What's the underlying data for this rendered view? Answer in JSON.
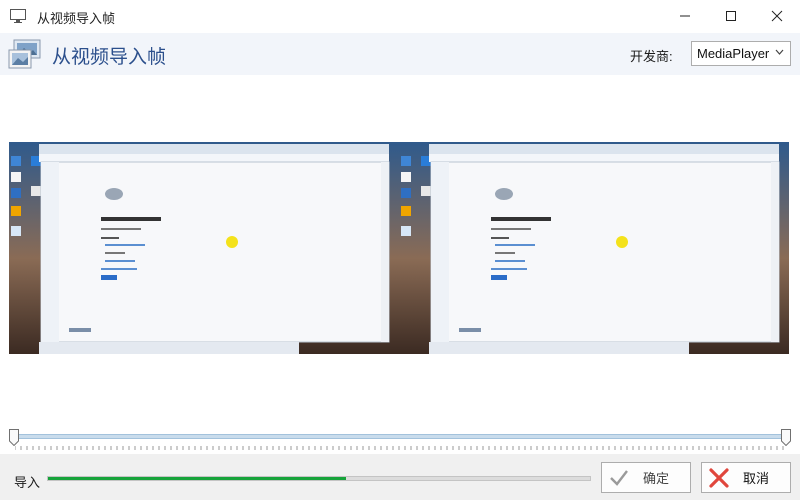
{
  "window": {
    "title": "从视频导入帧",
    "app_icon": "monitor-icon"
  },
  "header": {
    "title": "从视频导入帧",
    "icon": "film-frames-icon",
    "vendor_label": "开发商:",
    "vendor_value": "MediaPlayer"
  },
  "frames": [
    {
      "page_heading": "嗯… 无法访问此页面"
    },
    {
      "page_heading": "嗯… 无法访问此页面"
    }
  ],
  "bottom": {
    "import_label": "导入",
    "progress_fraction": 0.55,
    "ok_label": "确定",
    "cancel_label": "取消"
  },
  "colors": {
    "header_title": "#2b4f8c",
    "progress_fill": "#16a33a",
    "cancel_x": "#e0463c"
  }
}
